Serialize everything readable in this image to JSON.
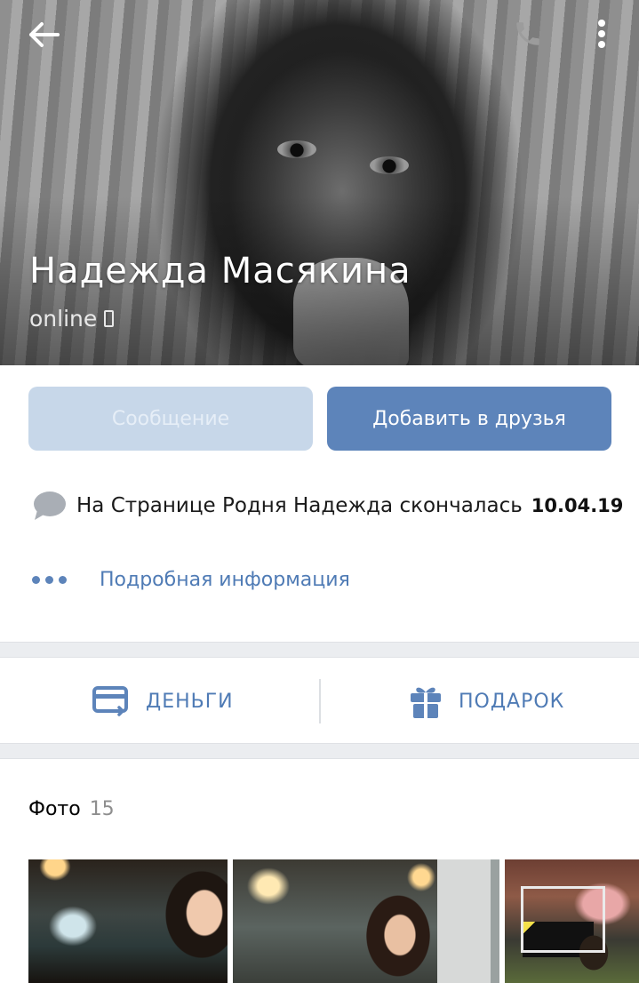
{
  "profile": {
    "name": "Надежда Масякина",
    "status": "online"
  },
  "actions": {
    "message_label": "Сообщение",
    "add_friend_label": "Добавить в друзья"
  },
  "status_line": {
    "text": "На Странице  Родня Надежда скончалась",
    "date": "10.04.19"
  },
  "details_link": "Подробная информация",
  "quick_actions": {
    "money_label": "ДЕНЬГИ",
    "gift_label": "ПОДАРОК"
  },
  "photos": {
    "title": "Фото",
    "count": "15"
  },
  "colors": {
    "accent": "#5d84ba",
    "link": "#4f7bb5",
    "button_disabled": "#c7d7e9"
  },
  "icons": [
    "back-arrow-icon",
    "phone-icon",
    "more-vertical-icon",
    "mobile-device-icon",
    "speech-bubble-icon",
    "more-horizontal-icon",
    "credit-card-icon",
    "gift-icon"
  ]
}
